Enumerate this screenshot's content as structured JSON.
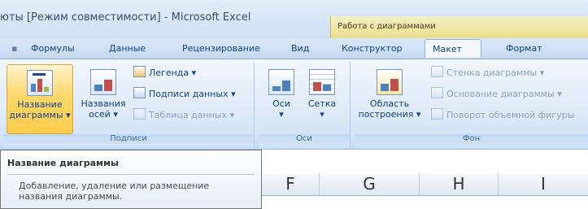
{
  "window": {
    "title": "юты  [Режим совместимости] - Microsoft Excel",
    "context_tab_group": "Работа с диаграммами"
  },
  "tabs": [
    {
      "label": "Формулы"
    },
    {
      "label": "Данные"
    },
    {
      "label": "Рецензирование"
    },
    {
      "label": "Вид"
    },
    {
      "label": "Конструктор"
    },
    {
      "label": "Макет",
      "active": true
    },
    {
      "label": "Формат"
    }
  ],
  "ribbon": {
    "labels_group": {
      "label": "Подписи",
      "chart_title": "Название\nдиаграммы ▾",
      "axis_titles": "Названия\nосей ▾",
      "legend": "Легенда ▾",
      "data_labels": "Подписи данных ▾",
      "data_table": "Таблица данных ▾"
    },
    "axes_group": {
      "label": "Оси",
      "axes": "Оси\n▾",
      "gridlines": "Сетка\n▾"
    },
    "background_group": {
      "label": "Фон",
      "plot_area": "Область\nпостроения ▾",
      "chart_wall": "Стенка диаграммы ▾",
      "chart_floor": "Основание диаграммы ▾",
      "rotation_3d": "Поворот объемной фигуры"
    }
  },
  "tooltip": {
    "title": "Название диаграммы",
    "body": "Добавление, удаление или размещение названия диаграммы."
  },
  "columns": [
    "F",
    "G",
    "H",
    "I"
  ],
  "colors": {
    "accent": "#15428b",
    "highlight": "#ffcc4d",
    "context_tab": "#eadf8d"
  }
}
